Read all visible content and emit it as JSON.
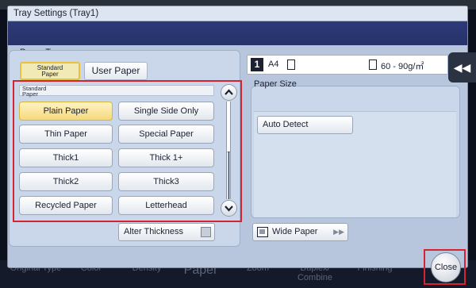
{
  "window": {
    "title": "Tray Settings (Tray1)"
  },
  "paper_type": {
    "label": "Paper Type",
    "tabs": [
      {
        "label": "Standard Paper",
        "selected": true
      },
      {
        "label": "User Paper",
        "selected": false
      }
    ],
    "group_label": "Standard Paper",
    "buttons": [
      {
        "label": "Plain Paper",
        "selected": true
      },
      {
        "label": "Single Side Only",
        "selected": false
      },
      {
        "label": "Thin Paper",
        "selected": false
      },
      {
        "label": "Special Paper",
        "selected": false
      },
      {
        "label": "Thick1",
        "selected": false
      },
      {
        "label": "Thick 1+",
        "selected": false
      },
      {
        "label": "Thick2",
        "selected": false
      },
      {
        "label": "Thick3",
        "selected": false
      },
      {
        "label": "Recycled Paper",
        "selected": false
      },
      {
        "label": "Letterhead",
        "selected": false
      }
    ],
    "alter_thickness_label": "Alter Thickness",
    "alter_thickness_checked": false
  },
  "status": {
    "tray_number": "1",
    "paper_size": "A4",
    "weight": "60 - 90g/㎡"
  },
  "paper_size": {
    "label": "Paper Size",
    "auto_detect_label": "Auto Detect",
    "wide_paper_label": "Wide Paper"
  },
  "close_label": "Close",
  "background_functions": [
    "Original Type",
    "Color",
    "Density",
    "Paper",
    "Zoom",
    "Duplex/ Combine",
    "Finishing"
  ]
}
